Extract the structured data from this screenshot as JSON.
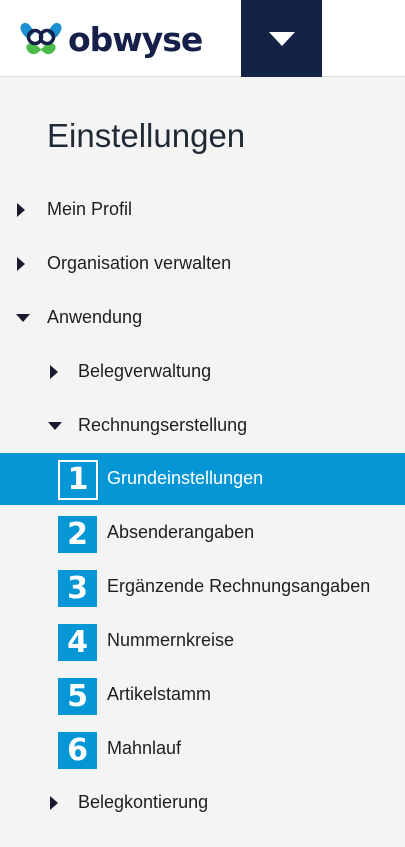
{
  "header": {
    "brand": "obwyse",
    "brand_colors": {
      "navy": "#14204a",
      "blue": "#1a8fd2",
      "green": "#4dbb4c"
    },
    "menu_icon": "caret-down-icon"
  },
  "panel": {
    "title": "Einstellungen",
    "items": [
      {
        "label": "Mein Profil",
        "state": "collapsed"
      },
      {
        "label": "Organisation verwalten",
        "state": "collapsed"
      },
      {
        "label": "Anwendung",
        "state": "expanded"
      },
      {
        "label": "Belegverwaltung",
        "state": "collapsed"
      },
      {
        "label": "Rechnungserstellung",
        "state": "expanded"
      },
      {
        "label": "Belegkontierung",
        "state": "collapsed"
      }
    ],
    "sub_items": [
      {
        "number": "1",
        "label": "Grundeinstellungen",
        "active": true
      },
      {
        "number": "2",
        "label": "Absenderangaben",
        "active": false
      },
      {
        "number": "3",
        "label": "Ergänzende Rechnungsangaben",
        "active": false
      },
      {
        "number": "4",
        "label": "Nummernkreise",
        "active": false
      },
      {
        "number": "5",
        "label": "Artikelstamm",
        "active": false
      },
      {
        "number": "6",
        "label": "Mahnlauf",
        "active": false
      }
    ]
  },
  "colors": {
    "accent": "#0596d6",
    "header_dark": "#132245",
    "background": "#f4f4f4"
  }
}
